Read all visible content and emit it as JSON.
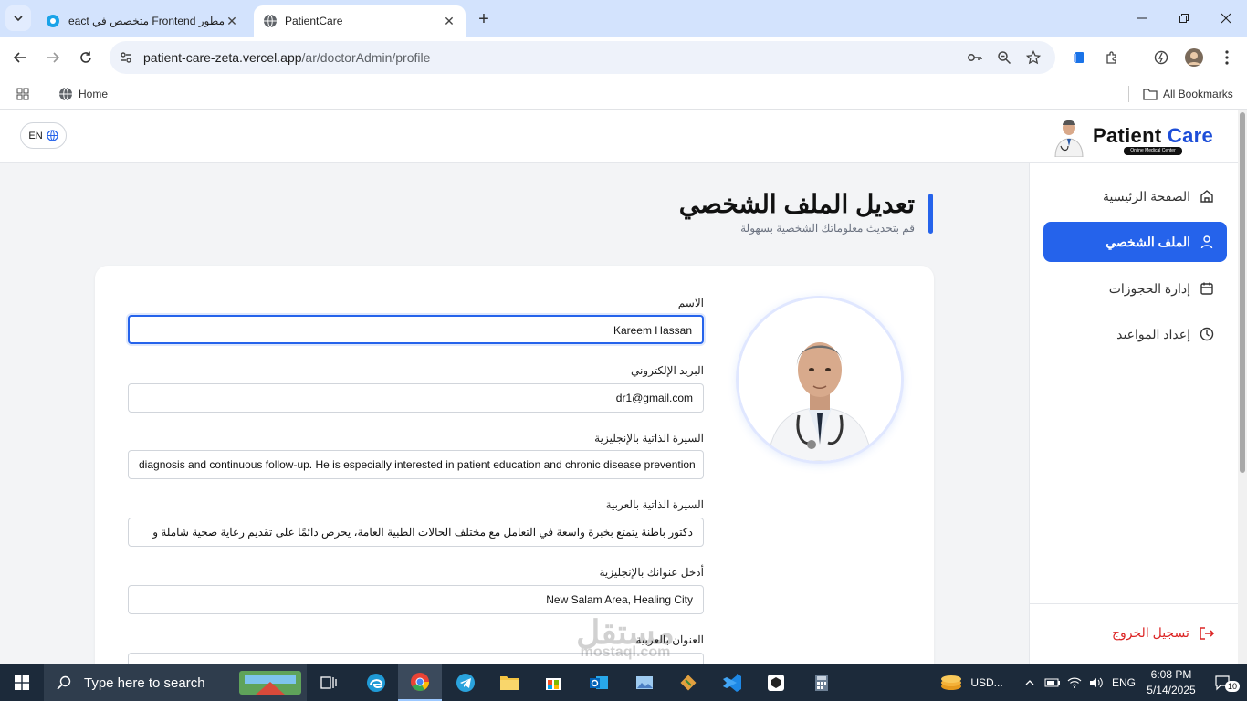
{
  "browser": {
    "tabs": [
      {
        "title": "مطور Frontend متخصص في React",
        "active": false
      },
      {
        "title": "PatientCare",
        "active": true
      }
    ],
    "url_host": "patient-care-zeta.vercel.app",
    "url_path": "/ar/doctorAdmin/profile",
    "bookmarks": {
      "home": "Home",
      "all": "All Bookmarks"
    }
  },
  "header": {
    "lang_button": "EN",
    "logo_patient": "Patient ",
    "logo_care": "Care",
    "logo_tag": "Online Medical Center"
  },
  "sidebar": {
    "items": [
      {
        "label": "الصفحة الرئيسية",
        "icon": "home-icon",
        "active": false
      },
      {
        "label": "الملف الشخصي",
        "icon": "user-icon",
        "active": true
      },
      {
        "label": "إدارة الحجوزات",
        "icon": "calendar-icon",
        "active": false
      },
      {
        "label": "إعداد المواعيد",
        "icon": "clock-icon",
        "active": false
      }
    ],
    "logout": "تسجيل الخروج"
  },
  "page": {
    "title": "تعديل الملف الشخصي",
    "subtitle": "قم بتحديث معلوماتك الشخصية بسهولة"
  },
  "form": {
    "fields": [
      {
        "label": "الاسم",
        "value": "Kareem Hassan"
      },
      {
        "label": "البريد الإلكتروني",
        "value": "dr1@gmail.com"
      },
      {
        "label": "السيرة الذاتية بالإنجليزية",
        "value": "diagnosis and continuous follow-up. He is especially interested in patient education and chronic disease prevention"
      },
      {
        "label": "السيرة الذاتية بالعربية",
        "value": "دكتور باطنة يتمتع بخبرة واسعة في التعامل مع مختلف الحالات الطبية العامة، يحرص دائمًا على تقديم رعاية صحية شاملة و"
      },
      {
        "label": "أدخل عنوانك بالإنجليزية",
        "value": "New Salam Area, Healing City"
      },
      {
        "label": "العنوان بالعربية",
        "value": ""
      }
    ]
  },
  "watermark": {
    "line1": "مستقل",
    "line2": "mostaql.com"
  },
  "taskbar": {
    "search_placeholder": "Type here to search",
    "currency": "USD...",
    "lang": "ENG",
    "time": "6:08 PM",
    "date": "5/14/2025",
    "notifications": "10"
  },
  "colors": {
    "accent": "#2563eb",
    "danger": "#dc2626"
  }
}
